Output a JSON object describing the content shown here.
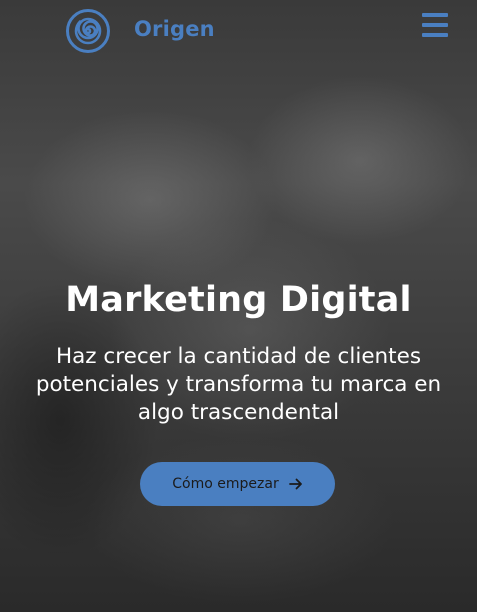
{
  "header": {
    "brand": "Origen",
    "logo_icon": "spiral-logo-icon",
    "menu_icon": "hamburger-menu-icon"
  },
  "hero": {
    "title": "Marketing Digital",
    "subtitle": "Haz crecer la cantidad de clientes potenciales y transforma tu marca en algo trascendental",
    "cta_label": "Cómo empezar",
    "cta_icon": "arrow-right-icon"
  },
  "colors": {
    "accent": "#4a7fc1",
    "text_light": "#ffffff",
    "button_text": "#1b1b1b"
  }
}
